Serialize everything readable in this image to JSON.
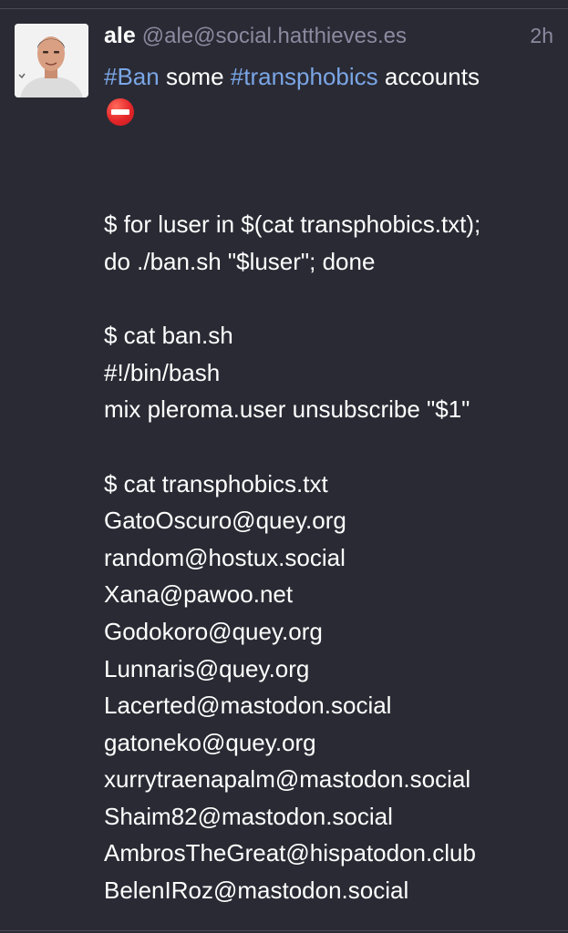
{
  "post": {
    "display_name": "ale",
    "handle": "@ale@social.hatthieves.es",
    "timestamp": "2h",
    "avatar_icon": "user-avatar-photo",
    "content": {
      "tag1": "#Ban",
      "text1": " some ",
      "tag2": "#transphobics",
      "text2": " accounts",
      "emoji": "no-entry-icon",
      "lines": {
        "cmd1": "$ for luser in $(cat transphobics.txt);",
        "cmd2": "do ./ban.sh \"$luser\"; done",
        "cat_ban": "$ cat ban.sh",
        "shebang": "#!/bin/bash",
        "mix_cmd": "mix pleroma.user unsubscribe \"$1\"",
        "cat_list": "$ cat transphobics.txt"
      },
      "accounts": [
        "GatoOscuro@quey.org",
        "random@hostux.social",
        "Xana@pawoo.net",
        "Godokoro@quey.org",
        "Lunnaris@quey.org",
        "Lacerted@mastodon.social",
        "gatoneko@quey.org",
        "xurrytraenapalm@mastodon.social",
        "Shaim82@mastodon.social",
        "AmbrosTheGreat@hispatodon.club",
        "BelenIRoz@mastodon.social"
      ]
    }
  },
  "colors": {
    "background": "#2a2a34",
    "text": "#ffffff",
    "muted": "#8a8aa0",
    "hashtag": "#7aa6e6",
    "no_entry": "#e5262a"
  }
}
